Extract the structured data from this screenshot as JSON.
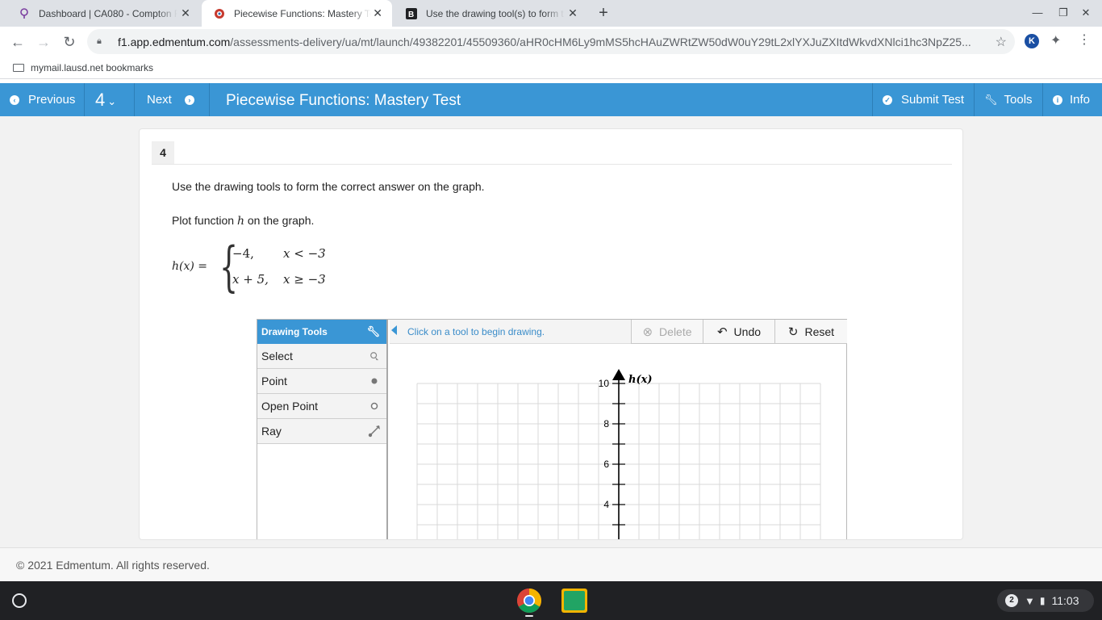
{
  "browser": {
    "tabs": [
      {
        "title": "Dashboard | CA080 - Compton F",
        "icon": "bulb-icon"
      },
      {
        "title": "Piecewise Functions: Mastery Te",
        "icon": "edmentum-icon",
        "active": true
      },
      {
        "title": "Use the drawing tool(s) to form t",
        "icon": "brainly-icon"
      }
    ],
    "url_host": "f1.app.edmentum.com",
    "url_path": "/assessments-delivery/ua/mt/launch/49382201/45509360/aHR0cHM6Ly9mMS5hcHAuZWRtZW50dW0uY29tL2xlYXJuZXItdWkvdXNlci1hc3NpZ25...",
    "bookmark_folder": "mymail.lausd.net bookmarks",
    "extension_letter": "K"
  },
  "toolbar": {
    "previous_label": "Previous",
    "question_number": "4",
    "next_label": "Next",
    "title": "Piecewise Functions: Mastery Test",
    "submit_label": "Submit Test",
    "tools_label": "Tools",
    "info_label": "Info",
    "accent_color": "#3a96d5"
  },
  "question": {
    "number": "4",
    "instruction": "Use the drawing tools to form the correct answer on the graph.",
    "prompt_before": "Plot function ",
    "prompt_var": "h",
    "prompt_after": " on the graph.",
    "lhs": "h(x) =",
    "case1_value": "−4,",
    "case1_condition": "x < −3",
    "case2_value": "x + 5,",
    "case2_condition": "x ≥ −3"
  },
  "drawing_tools": {
    "header": "Drawing Tools",
    "tools": [
      "Select",
      "Point",
      "Open Point",
      "Ray"
    ],
    "hint": "Click on a tool to begin drawing.",
    "delete_label": "Delete",
    "undo_label": "Undo",
    "reset_label": "Reset"
  },
  "graph": {
    "y_axis_label": "h(x)",
    "y_ticks_labeled": [
      "10",
      "8",
      "6",
      "4"
    ]
  },
  "footer": {
    "copyright": "© 2021 Edmentum. All rights reserved."
  },
  "system_tray": {
    "notifications": "2",
    "time": "11:03"
  }
}
